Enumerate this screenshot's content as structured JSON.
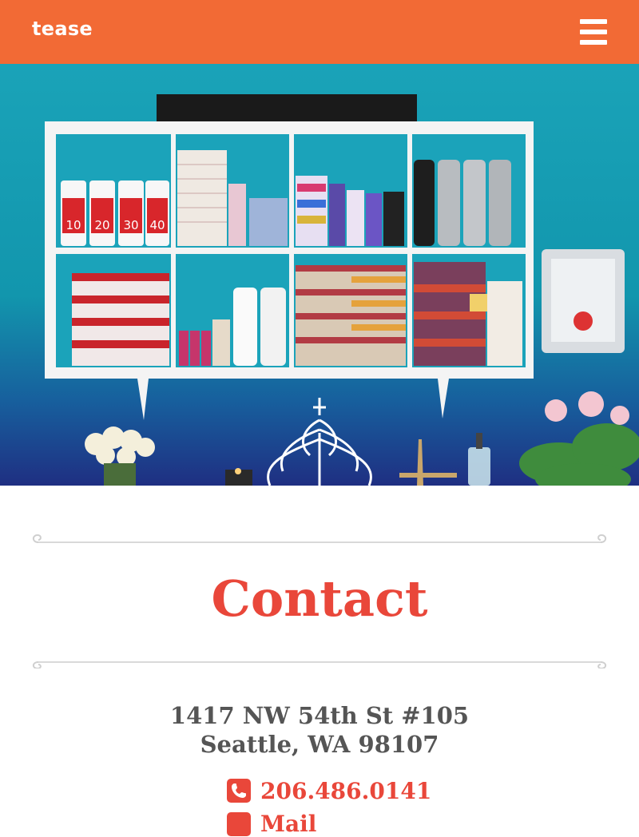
{
  "header": {
    "logo_text": "tease",
    "menu_icon": "hamburger-menu-icon",
    "background_color": "#f26a35"
  },
  "hero": {
    "image_description_icon": "salon-shelf-photo",
    "product_labels": [
      "10",
      "20",
      "30",
      "40"
    ]
  },
  "main": {
    "title": "Contact",
    "address_line1": "1417 NW 54th St #105",
    "address_line2": "Seattle, WA 98107",
    "phone": "206.486.0141",
    "phone_icon": "phone-icon",
    "mail_label": "Mail",
    "mail_icon": "mail-icon"
  },
  "colors": {
    "accent": "#e9473a",
    "header": "#f26a35",
    "text": "#555555",
    "hero_teal": "#1aa3b8"
  }
}
